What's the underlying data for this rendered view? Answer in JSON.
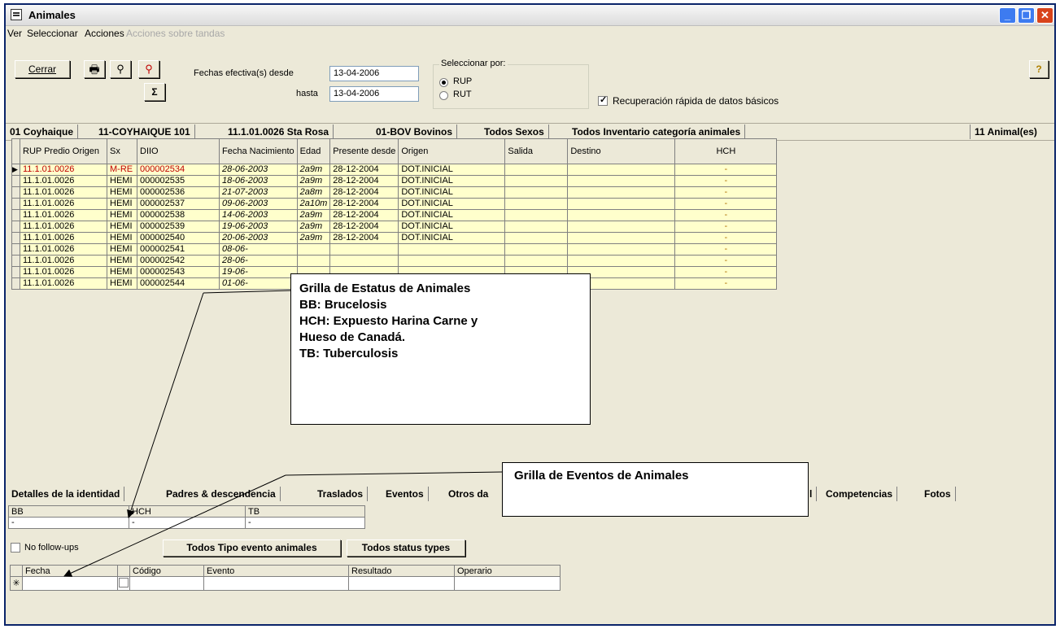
{
  "window": {
    "title": "Animales"
  },
  "menu": [
    "Ver",
    "Seleccionar",
    "Acciones",
    "Acciones sobre tandas"
  ],
  "toolbar": {
    "close_label": "Cerrar",
    "dates_from_label": "Fechas efectiva(s) desde",
    "dates_from_value": "13-04-2006",
    "dates_to_label": "hasta",
    "dates_to_value": "13-04-2006",
    "sum_label": "Σ",
    "select_by": {
      "title": "Seleccionar por:",
      "options": [
        "RUP",
        "RUT"
      ],
      "selected": "RUP"
    },
    "quick_recovery_label": "Recuperación rápida de datos básicos",
    "quick_recovery_checked": true
  },
  "filters": [
    "01 Coyhaique",
    "11-COYHAIQUE 101",
    "11.1.01.0026 Sta Rosa",
    "01-BOV Bovinos",
    "Todos Sexos",
    "Todos Inventario categoría animales"
  ],
  "count_label": "11 Animal(es)",
  "main_grid": {
    "columns": [
      "RUP Predio Origen",
      "Sx",
      "DIIO",
      "Fecha Nacimiento",
      "Edad",
      "Presente desde",
      "Origen",
      "Salida",
      "Destino",
      "HCH"
    ],
    "rows": [
      [
        "11.1.01.0026",
        "M-RE",
        "000002534",
        "28-06-2003",
        "2a9m",
        "28-12-2004",
        "DOT.INICIAL",
        "",
        "",
        "-"
      ],
      [
        "11.1.01.0026",
        "HEMI",
        "000002535",
        "18-06-2003",
        "2a9m",
        "28-12-2004",
        "DOT.INICIAL",
        "",
        "",
        "-"
      ],
      [
        "11.1.01.0026",
        "HEMI",
        "000002536",
        "21-07-2003",
        "2a8m",
        "28-12-2004",
        "DOT.INICIAL",
        "",
        "",
        "-"
      ],
      [
        "11.1.01.0026",
        "HEMI",
        "000002537",
        "09-06-2003",
        "2a10m",
        "28-12-2004",
        "DOT.INICIAL",
        "",
        "",
        "-"
      ],
      [
        "11.1.01.0026",
        "HEMI",
        "000002538",
        "14-06-2003",
        "2a9m",
        "28-12-2004",
        "DOT.INICIAL",
        "",
        "",
        "-"
      ],
      [
        "11.1.01.0026",
        "HEMI",
        "000002539",
        "19-06-2003",
        "2a9m",
        "28-12-2004",
        "DOT.INICIAL",
        "",
        "",
        "-"
      ],
      [
        "11.1.01.0026",
        "HEMI",
        "000002540",
        "20-06-2003",
        "2a9m",
        "28-12-2004",
        "DOT.INICIAL",
        "",
        "",
        "-"
      ],
      [
        "11.1.01.0026",
        "HEMI",
        "000002541",
        "08-06-",
        "",
        "",
        "",
        "",
        "",
        "-"
      ],
      [
        "11.1.01.0026",
        "HEMI",
        "000002542",
        "28-06-",
        "",
        "",
        "",
        "",
        "",
        "-"
      ],
      [
        "11.1.01.0026",
        "HEMI",
        "000002543",
        "19-06-",
        "",
        "",
        "",
        "",
        "",
        "-"
      ],
      [
        "11.1.01.0026",
        "HEMI",
        "000002544",
        "01-06-",
        "",
        "",
        "",
        "",
        "",
        "-"
      ]
    ]
  },
  "callout_status": [
    "Grilla de Estatus de Animales",
    "BB: Brucelosis",
    "HCH: Expuesto Harina Carne y",
    "Hueso de Canadá.",
    "TB: Tuberculosis"
  ],
  "callout_events": "Grilla de Eventos de Animales",
  "tabs": [
    "Detalles de la identidad",
    "Padres & descendencia",
    "Traslados",
    "Eventos",
    "Otros da",
    "l",
    "Competencias",
    "Fotos"
  ],
  "status_grid": {
    "columns": [
      "BB",
      "HCH",
      "TB"
    ],
    "values": [
      "-",
      "-",
      "-"
    ]
  },
  "no_followups_label": "No follow-ups",
  "event_type_button": "Todos Tipo evento animales",
  "status_types_button": "Todos status types",
  "events_grid": {
    "columns": [
      "Fecha",
      "",
      "Código",
      "Evento",
      "Resultado",
      "Operario"
    ],
    "new_row_marker": "✳"
  },
  "colors": {
    "grid_bg": "#ffffcc",
    "highlight": "#c00000",
    "title_bar_close": "#d8431b"
  }
}
